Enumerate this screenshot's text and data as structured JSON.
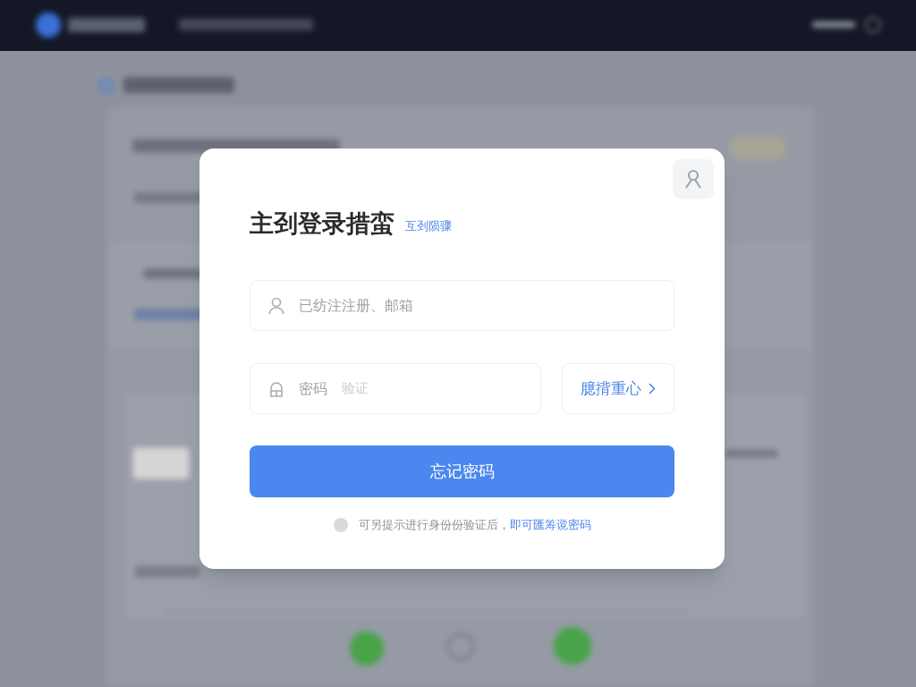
{
  "dialog": {
    "title": "主刭登录措蛮",
    "title_link": "互刭陨骤",
    "username_field": {
      "placeholder": "已纺注注册、邮箱"
    },
    "password_field": {
      "label": "密码",
      "placeholder": "验证"
    },
    "side_button": {
      "label": "臆揹重心"
    },
    "submit_button": {
      "label": "忘记密码"
    },
    "agreement": {
      "checked": false,
      "text": "可另提示进行身份份验证后，",
      "link": "即可匯筹谠密码"
    }
  }
}
